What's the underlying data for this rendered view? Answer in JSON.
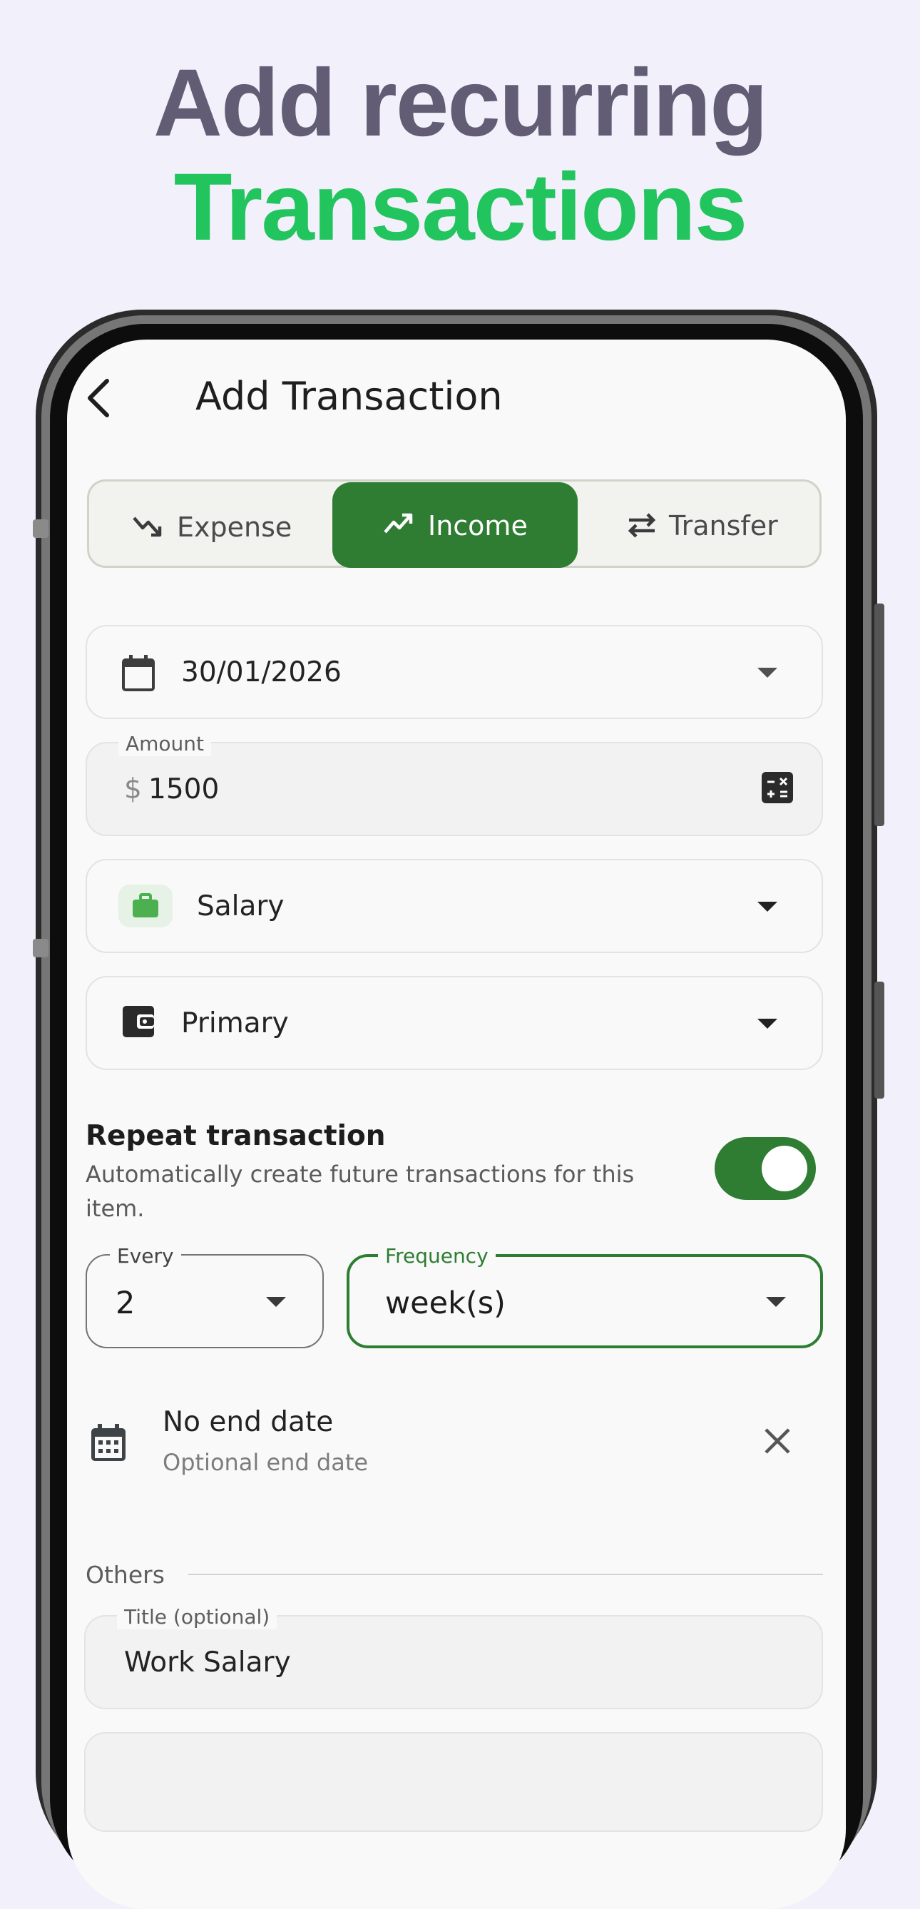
{
  "headline": {
    "line1": "Add recurring",
    "line2": "Transactions"
  },
  "appbar": {
    "title": "Add Transaction",
    "back_icon": "arrow-back-icon"
  },
  "type_selector": {
    "options": [
      {
        "label": "Expense",
        "icon": "trending-down-icon",
        "selected": false
      },
      {
        "label": "Income",
        "icon": "trending-up-icon",
        "selected": true
      },
      {
        "label": "Transfer",
        "icon": "swap-horizontal-icon",
        "selected": false
      }
    ],
    "selected_color": "#2e7d32"
  },
  "date_field": {
    "value": "30/01/2026",
    "icon": "calendar-icon"
  },
  "amount_field": {
    "label": "Amount",
    "currency": "$",
    "value": "1500",
    "icon": "calculator-icon"
  },
  "category_field": {
    "value": "Salary",
    "icon": "briefcase-icon",
    "icon_color": "#4caf50"
  },
  "account_field": {
    "value": "Primary",
    "icon": "wallet-icon"
  },
  "repeat": {
    "title": "Repeat transaction",
    "subtitle": "Automatically create future transactions for this item.",
    "enabled": true,
    "every": {
      "label": "Every",
      "value": "2"
    },
    "frequency": {
      "label": "Frequency",
      "value": "week(s)"
    },
    "end_date": {
      "title": "No end date",
      "subtitle": "Optional end date",
      "icon": "calendar-month-icon",
      "clear_icon": "close-icon"
    }
  },
  "others": {
    "section_label": "Others",
    "title_field": {
      "label": "Title (optional)",
      "value": "Work Salary"
    }
  },
  "colors": {
    "accent": "#2e7d32",
    "headline_primary": "#625d75",
    "headline_accent": "#22c45e",
    "background": "#f2f0fa"
  }
}
